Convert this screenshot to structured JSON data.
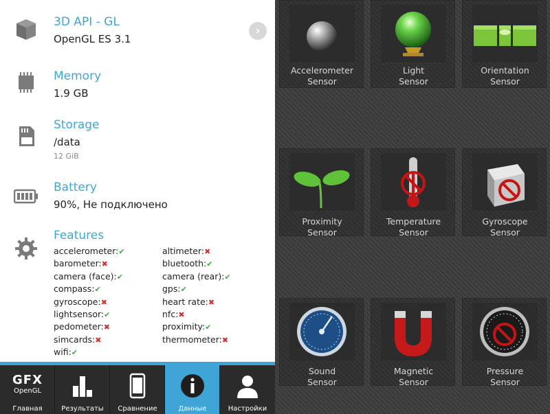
{
  "info": {
    "api": {
      "title": "3D API - GL",
      "value": "OpenGL ES 3.1",
      "icon": "cube-icon"
    },
    "memory": {
      "title": "Memory",
      "value": "1.9 GB",
      "icon": "chip-icon"
    },
    "storage": {
      "title": "Storage",
      "value": "/data",
      "sub": "12 GiB",
      "icon": "sd-card-icon"
    },
    "battery": {
      "title": "Battery",
      "value": "90%, Не подключено",
      "icon": "battery-icon"
    },
    "features": {
      "title": "Features",
      "icon": "gear-icon",
      "left": [
        {
          "name": "accelerometer:",
          "ok": true
        },
        {
          "name": "barometer:",
          "ok": false
        },
        {
          "name": "camera (face):",
          "ok": true
        },
        {
          "name": "compass:",
          "ok": true
        },
        {
          "name": "gyroscope:",
          "ok": false
        },
        {
          "name": "lightsensor:",
          "ok": true
        },
        {
          "name": "pedometer:",
          "ok": false
        },
        {
          "name": "simcards:",
          "ok": false
        },
        {
          "name": "wifi:",
          "ok": true
        }
      ],
      "right": [
        {
          "name": "altimeter:",
          "ok": false
        },
        {
          "name": "bluetooth:",
          "ok": true
        },
        {
          "name": "camera (rear):",
          "ok": true
        },
        {
          "name": "gps:",
          "ok": true
        },
        {
          "name": "heart rate:",
          "ok": false
        },
        {
          "name": "nfc:",
          "ok": false
        },
        {
          "name": "proximity:",
          "ok": true
        },
        {
          "name": "thermometer:",
          "ok": false
        }
      ],
      "ok_mark": "✔",
      "no_mark": "✖"
    }
  },
  "nav": {
    "items": [
      {
        "label": "Главная",
        "logo_top": "GFX",
        "logo_bottom": "OpenGL",
        "icon": "gfx-logo-icon"
      },
      {
        "label": "Результаты",
        "icon": "bar-chart-icon"
      },
      {
        "label": "Сравнение",
        "icon": "phone-icon"
      },
      {
        "label": "Данные",
        "icon": "info-icon",
        "active": true
      },
      {
        "label": "Настройки",
        "icon": "person-icon"
      }
    ]
  },
  "sensors": [
    {
      "line1": "Accelerometer",
      "line2": "Sensor",
      "icon": "metal-ball-icon",
      "available": true
    },
    {
      "line1": "Light",
      "line2": "Sensor",
      "icon": "crystal-ball-icon",
      "available": true
    },
    {
      "line1": "Orientation",
      "line2": "Sensor",
      "icon": "spirit-level-icon",
      "available": true
    },
    {
      "line1": "Proximity",
      "line2": "Sensor",
      "icon": "sprout-icon",
      "available": true
    },
    {
      "line1": "Temperature",
      "line2": "Sensor",
      "icon": "thermometer-icon",
      "available": false
    },
    {
      "line1": "Gyroscope",
      "line2": "Sensor",
      "icon": "cube-icon",
      "available": false
    },
    {
      "line1": "Sound",
      "line2": "Sensor",
      "icon": "gauge-icon",
      "available": true
    },
    {
      "line1": "Magnetic",
      "line2": "Sensor",
      "icon": "magnet-icon",
      "available": true
    },
    {
      "line1": "Pressure",
      "line2": "Sensor",
      "icon": "pressure-gauge-icon",
      "available": false
    }
  ],
  "colors": {
    "accent": "#3ea6d6",
    "ok": "#3cae3c",
    "no": "#d23030",
    "nav_bg": "#2b2b2b"
  }
}
